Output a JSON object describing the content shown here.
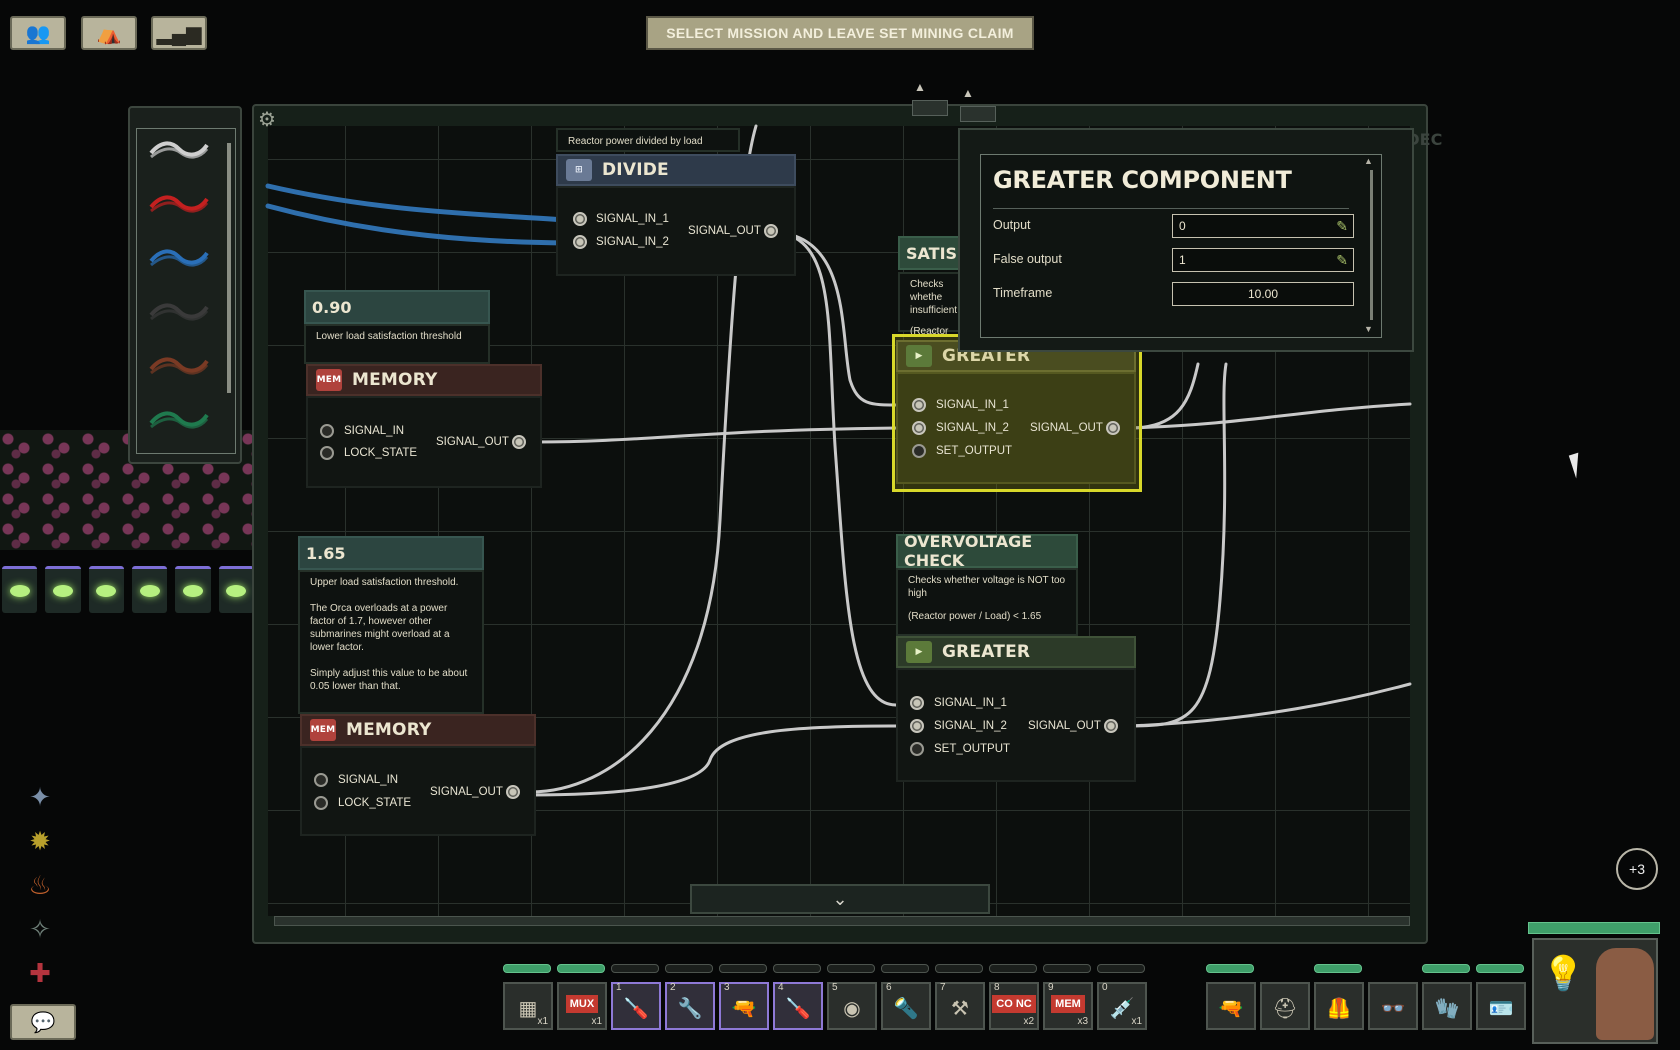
{
  "top_bar": {
    "crew_icon": "crew-icon",
    "mission_icon": "mission-icon",
    "stats_icon": "stats-icon",
    "mission_button_label": "SELECT MISSION AND LEAVE SET MINING CLAIM"
  },
  "wires": [
    {
      "name": "white-wire",
      "color": "#cfcfcf"
    },
    {
      "name": "red-wire",
      "color": "#c42020"
    },
    {
      "name": "blue-wire",
      "color": "#2a6fb8"
    },
    {
      "name": "black-wire",
      "color": "#3a3a3a"
    },
    {
      "name": "brown-wire",
      "color": "#7a3a24"
    },
    {
      "name": "green-wire",
      "color": "#1f7a4e"
    }
  ],
  "divide": {
    "description": "Reactor power divided by load",
    "title": "DIVIDE",
    "in1": "SIGNAL_IN_1",
    "in2": "SIGNAL_IN_2",
    "out": "SIGNAL_OUT"
  },
  "memory_low": {
    "value": "0.90",
    "description": "Lower load satisfaction threshold",
    "title": "MEMORY",
    "in": "SIGNAL_IN",
    "lock": "LOCK_STATE",
    "out": "SIGNAL_OUT"
  },
  "memory_high": {
    "value": "1.65",
    "description_1": "Upper load satisfaction threshold.",
    "description_2": "The Orca overloads at a power factor of 1.7, however other submarines might overload at a lower factor.",
    "description_3": "Simply adjust this value to be about 0.05 lower than that.",
    "title": "MEMORY",
    "in": "SIGNAL_IN",
    "lock": "LOCK_STATE",
    "out": "SIGNAL_OUT"
  },
  "satisfaction": {
    "title_partial": "SATISFACT",
    "desc_line1": "Checks whethe",
    "desc_line2": "insufficient",
    "desc_line3": "(Reactor powe"
  },
  "greater_selected": {
    "title_partial": "GREATER",
    "in1": "SIGNAL_IN_1",
    "in2": "SIGNAL_IN_2",
    "set": "SET_OUTPUT",
    "out": "SIGNAL_OUT"
  },
  "overvoltage": {
    "title": "OVERVOLTAGE CHECK",
    "desc_1": "Checks whether voltage is NOT too high",
    "desc_2": "(Reactor power / Load) < 1.65",
    "comp_title": "GREATER",
    "in1": "SIGNAL_IN_1",
    "in2": "SIGNAL_IN_2",
    "set": "SET_OUTPUT",
    "out": "SIGNAL_OUT"
  },
  "battery_partial": "BATTERY MODE DEC",
  "popup": {
    "title": "GREATER COMPONENT",
    "rows": [
      {
        "label": "Output",
        "value": "0"
      },
      {
        "label": "False output",
        "value": "1"
      },
      {
        "label": "Timeframe",
        "value": "10.00"
      }
    ]
  },
  "hotbar": {
    "slots": [
      {
        "num": "",
        "icon": "circuit-icon",
        "count": "x1"
      },
      {
        "num": "",
        "icon": "mux-icon",
        "label": "MUX",
        "count": "x1"
      },
      {
        "num": "1",
        "icon": "screwdriver-icon",
        "count": ""
      },
      {
        "num": "2",
        "icon": "wrench-icon",
        "count": ""
      },
      {
        "num": "3",
        "icon": "gun-icon",
        "count": ""
      },
      {
        "num": "4",
        "icon": "screwdriver-icon",
        "count": ""
      },
      {
        "num": "5",
        "icon": "diving-mask-icon",
        "count": ""
      },
      {
        "num": "6",
        "icon": "flashlight-icon",
        "count": ""
      },
      {
        "num": "7",
        "icon": "welding-tool-icon",
        "count": ""
      },
      {
        "num": "8",
        "icon": "concat-component-icon",
        "label": "CO NC",
        "count": "x2"
      },
      {
        "num": "9",
        "icon": "memory-component-icon",
        "label": "MEM",
        "count": "x3"
      },
      {
        "num": "0",
        "icon": "syringe-icon",
        "count": "x1"
      }
    ],
    "equipment": [
      "smg-icon",
      "helmet-icon",
      "armor-vest-icon",
      "goggles-icon",
      "gloves-icon",
      "id-card-icon"
    ]
  },
  "notification_count": "+3",
  "side_icons": [
    "talent-electrical-icon",
    "talent-engineering-icon",
    "talent-fire-icon",
    "talent-skill-icon",
    "talent-medical-icon"
  ]
}
